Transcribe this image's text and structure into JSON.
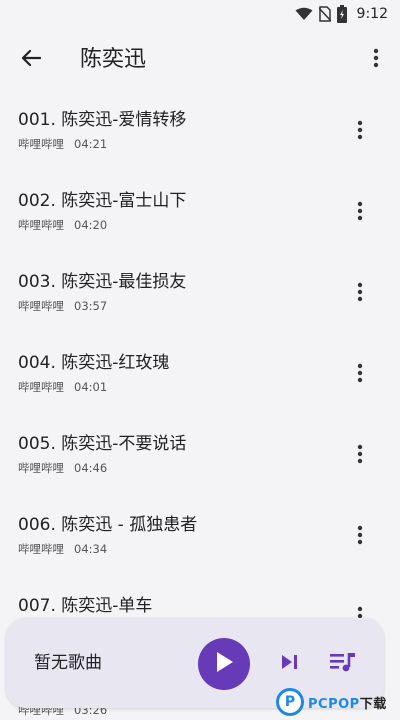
{
  "status_bar": {
    "time": "9:12",
    "icons": [
      "wifi-icon",
      "no-sim-icon",
      "battery-charging-icon"
    ]
  },
  "app_bar": {
    "back_icon": "arrow-left-icon",
    "title": "陈奕迅",
    "overflow_icon": "more-vertical-icon"
  },
  "songs": [
    {
      "title": "001. 陈奕迅-爱情转移",
      "source": "哔哩哔哩",
      "duration": "04:21"
    },
    {
      "title": "002. 陈奕迅-富士山下",
      "source": "哔哩哔哩",
      "duration": "04:20"
    },
    {
      "title": "003. 陈奕迅-最佳损友",
      "source": "哔哩哔哩",
      "duration": "03:57"
    },
    {
      "title": "004. 陈奕迅-红玫瑰",
      "source": "哔哩哔哩",
      "duration": "04:01"
    },
    {
      "title": "005. 陈奕迅-不要说话",
      "source": "哔哩哔哩",
      "duration": "04:46"
    },
    {
      "title": "006. 陈奕迅 - 孤独患者",
      "source": "哔哩哔哩",
      "duration": "04:34"
    },
    {
      "title": "007. 陈奕迅-单车",
      "source": "哔哩哔哩",
      "duration": "03:26"
    }
  ],
  "mini_player": {
    "title": "暂无歌曲",
    "play_icon": "play-icon",
    "next_icon": "skip-next-icon",
    "queue_icon": "queue-music-icon",
    "accent_color": "#673ab7"
  },
  "watermark": {
    "logo_letter": "P",
    "brand": "PCPOP",
    "suffix": "下载"
  }
}
